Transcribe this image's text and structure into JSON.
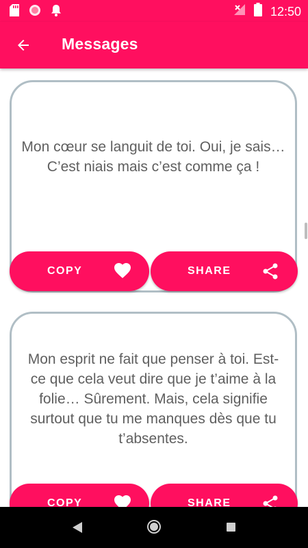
{
  "status_bar": {
    "time": "12:50",
    "icons": [
      "sd-card-icon",
      "circle-notification-icon",
      "bell-icon",
      "no-signal-icon",
      "battery-icon"
    ]
  },
  "app_bar": {
    "title": "Messages",
    "back_icon": "arrow-back-icon"
  },
  "colors": {
    "primary": "#ff0f5f",
    "card_border": "#b0bec5",
    "text": "#5f5f5f"
  },
  "messages": [
    {
      "text": "Mon cœur se languit de toi. Oui, je sais… C’est niais mais c’est comme ça !",
      "copy_label": "COPY",
      "share_label": "SHARE"
    },
    {
      "text": "Mon esprit ne fait que penser à toi. Est-ce que cela veut dire que je t’aime à la folie… Sûrement. Mais, cela signifie surtout que tu me manques dès que tu t’absentes.",
      "copy_label": "COPY",
      "share_label": "SHARE"
    }
  ]
}
